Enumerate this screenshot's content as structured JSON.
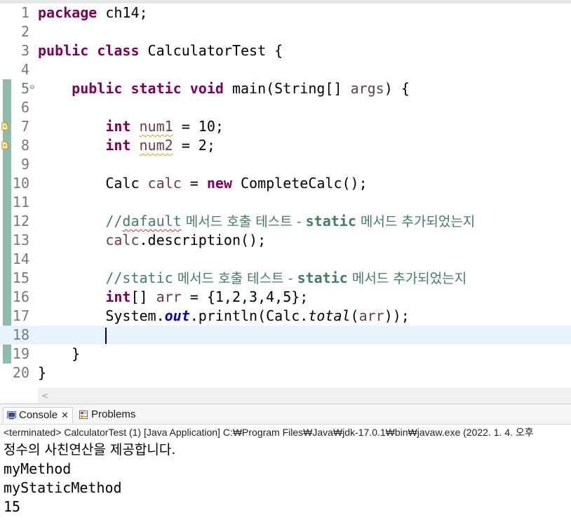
{
  "editor": {
    "lines": [
      {
        "number": "1",
        "tokens": [
          {
            "cls": "kw",
            "text": "package"
          },
          {
            "cls": "",
            "text": " ch14;"
          }
        ]
      },
      {
        "number": "2",
        "tokens": []
      },
      {
        "number": "3",
        "tokens": [
          {
            "cls": "kw",
            "text": "public"
          },
          {
            "cls": "",
            "text": " "
          },
          {
            "cls": "kw",
            "text": "class"
          },
          {
            "cls": "",
            "text": " CalculatorTest {"
          }
        ]
      },
      {
        "number": "4",
        "tokens": []
      },
      {
        "number": "5",
        "fold": "⊖",
        "tokens": [
          {
            "cls": "",
            "text": "    "
          },
          {
            "cls": "kw",
            "text": "public"
          },
          {
            "cls": "",
            "text": " "
          },
          {
            "cls": "kw",
            "text": "static"
          },
          {
            "cls": "",
            "text": " "
          },
          {
            "cls": "kw",
            "text": "void"
          },
          {
            "cls": "",
            "text": " main(String[] "
          },
          {
            "cls": "var-local",
            "text": "args"
          },
          {
            "cls": "",
            "text": ") {"
          }
        ]
      },
      {
        "number": "6",
        "tokens": []
      },
      {
        "number": "7",
        "marker": true,
        "tokens": [
          {
            "cls": "",
            "text": "        "
          },
          {
            "cls": "kw",
            "text": "int"
          },
          {
            "cls": "",
            "text": " "
          },
          {
            "cls": "var-local squiggle",
            "text": "num1"
          },
          {
            "cls": "",
            "text": " = 10;"
          }
        ]
      },
      {
        "number": "8",
        "marker": true,
        "tokens": [
          {
            "cls": "",
            "text": "        "
          },
          {
            "cls": "kw",
            "text": "int"
          },
          {
            "cls": "",
            "text": " "
          },
          {
            "cls": "var-local squiggle",
            "text": "num2"
          },
          {
            "cls": "",
            "text": " = 2;"
          }
        ]
      },
      {
        "number": "9",
        "tokens": []
      },
      {
        "number": "10",
        "tokens": [
          {
            "cls": "",
            "text": "        Calc "
          },
          {
            "cls": "var-local",
            "text": "calc"
          },
          {
            "cls": "",
            "text": " = "
          },
          {
            "cls": "kw",
            "text": "new"
          },
          {
            "cls": "",
            "text": " CompleteCalc();"
          }
        ]
      },
      {
        "number": "11",
        "tokens": []
      },
      {
        "number": "12",
        "tokens": [
          {
            "cls": "",
            "text": "        "
          },
          {
            "cls": "cm",
            "text": "//"
          },
          {
            "cls": "cm squiggle-red",
            "text": "dafault"
          },
          {
            "cls": "cm-kr",
            "text": " 메서드 호출 테스트 - "
          },
          {
            "cls": "cm-kw",
            "text": "static"
          },
          {
            "cls": "cm-kr",
            "text": " 메서드 추가되었는지"
          }
        ]
      },
      {
        "number": "13",
        "tokens": [
          {
            "cls": "",
            "text": "        "
          },
          {
            "cls": "var-local",
            "text": "calc"
          },
          {
            "cls": "",
            "text": ".description();"
          }
        ]
      },
      {
        "number": "14",
        "tokens": []
      },
      {
        "number": "15",
        "tokens": [
          {
            "cls": "",
            "text": "        "
          },
          {
            "cls": "cm",
            "text": "//static"
          },
          {
            "cls": "cm-kr",
            "text": " 메서드 호출 테스트 - "
          },
          {
            "cls": "cm-kw",
            "text": "static"
          },
          {
            "cls": "cm-kr",
            "text": " 메서드 추가되었는지"
          }
        ]
      },
      {
        "number": "16",
        "tokens": [
          {
            "cls": "",
            "text": "        "
          },
          {
            "cls": "kw",
            "text": "int"
          },
          {
            "cls": "",
            "text": "[] "
          },
          {
            "cls": "var-local",
            "text": "arr"
          },
          {
            "cls": "",
            "text": " = {1,2,3,4,5};"
          }
        ]
      },
      {
        "number": "17",
        "tokens": [
          {
            "cls": "",
            "text": "        System."
          },
          {
            "cls": "field-static",
            "text": "out"
          },
          {
            "cls": "",
            "text": ".println(Calc."
          },
          {
            "cls": "method-static",
            "text": "total"
          },
          {
            "cls": "",
            "text": "("
          },
          {
            "cls": "var-local",
            "text": "arr"
          },
          {
            "cls": "",
            "text": "));"
          }
        ]
      },
      {
        "number": "18",
        "current": true,
        "caret": true,
        "tokens": [
          {
            "cls": "",
            "text": "        "
          }
        ]
      },
      {
        "number": "19",
        "tokens": [
          {
            "cls": "",
            "text": "    }"
          }
        ]
      },
      {
        "number": "20",
        "tokens": [
          {
            "cls": "",
            "text": "}"
          }
        ]
      }
    ],
    "scroll_left_glyph": "<"
  },
  "console": {
    "tabs": [
      {
        "label": "Console",
        "icon": "console-icon",
        "close": "✕",
        "active": true
      },
      {
        "label": "Problems",
        "icon": "problems-icon",
        "active": false
      }
    ],
    "status": "<terminated> CalculatorTest (1) [Java Application] C:₩Program Files₩Java₩jdk-17.0.1₩bin₩javaw.exe  (2022. 1. 4. 오후",
    "output": [
      "정수의 사친연산을 제공합니다.",
      "myMethod",
      "myStaticMethod",
      "15"
    ]
  },
  "colors": {
    "keyword": "#7f0055",
    "comment": "#3f7f5f",
    "static_field": "#0000c0",
    "local_variable": "#6a3e3e",
    "current_line": "#e8f2fe",
    "change_bar": "#8fbcaa"
  }
}
